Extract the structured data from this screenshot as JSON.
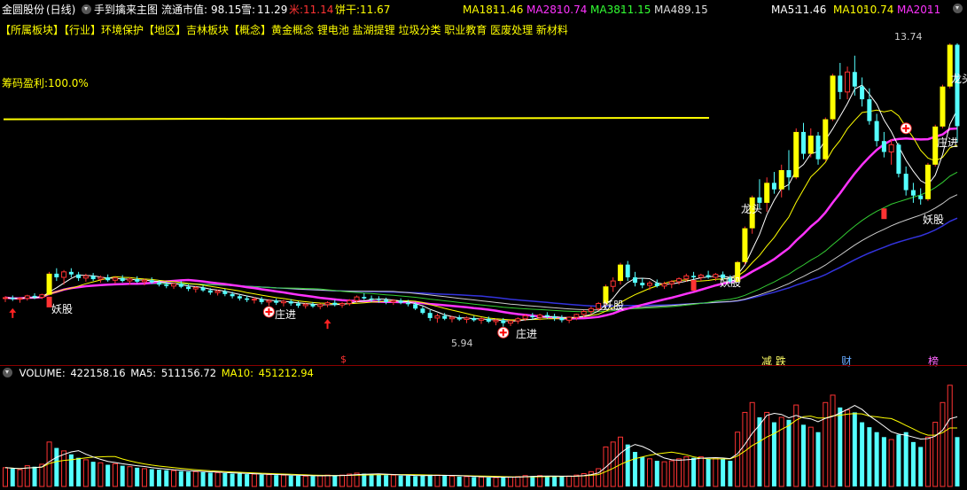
{
  "title_bar": {
    "stock_name": "金圆股份",
    "period": "(日线)",
    "formula_name": "手到擒来主图",
    "market_cap_label": "流通市值:",
    "market_cap_value": "98.15",
    "xue_label": "雪:",
    "xue_value": "11.29",
    "mi_label": "米:",
    "mi_value": "11.14",
    "bing_label": "饼干:",
    "bing_value": "11.67",
    "ma_mid": [
      {
        "label": "MA18:",
        "value": "11.46",
        "color": "#ffff00"
      },
      {
        "label": "MA28:",
        "value": "10.74",
        "color": "#ff33ff"
      },
      {
        "label": "MA38:",
        "value": "11.15",
        "color": "#33ff33"
      },
      {
        "label": "MA48:",
        "value": "9.15",
        "color": "#dddddd"
      }
    ],
    "ma_right": [
      {
        "label": "MA5:",
        "value": "11.46",
        "color": "#ffffff"
      },
      {
        "label": "MA10:",
        "value": "10.74",
        "color": "#ffff00"
      },
      {
        "label": "MA20:",
        "value": "11",
        "color": "#ff33ff"
      }
    ]
  },
  "sector_bar": "【所属板块】【行业】环境保护【地区】吉林板块【概念】黄金概念 锂电池 盐湖提锂 垃圾分类 职业教育 医废处理 新材料",
  "chip_profit": "筹码盈利:100.0%",
  "annotations": {
    "yaogu_1": "妖股",
    "yaogu_2": "妖股",
    "yaogu_3": "妖股",
    "yaogu_4": "妖股",
    "zhuangjin_1": "庄进",
    "zhuangjin_2": "庄进",
    "zhuangjin_3": "庄进",
    "longtou_1": "龙头",
    "longtou_2": "龙头",
    "low_price": "5.94",
    "high_price": "13.74",
    "dollar_mark": "$",
    "jian_die": "减 跌",
    "cai": "财",
    "bang": "榜"
  },
  "volume_bar": {
    "volume_label": "VOLUME:",
    "volume_value": "422158.16",
    "ma5_label": "MA5:",
    "ma5_value": "511156.72",
    "ma10_label": "MA10:",
    "ma10_value": "451212.94"
  },
  "colors": {
    "up": "#ff3333",
    "down": "#54ffff",
    "ma5": "#ffffff",
    "ma10": "#ffff00",
    "ma20": "#ff33ff",
    "ma38": "#33cc33",
    "ma48": "#cccccc",
    "long": "#3333dd",
    "chip": "#ffff00"
  },
  "chart_data": {
    "type": "candlestick",
    "price_range": [
      5.3,
      14.2
    ],
    "candles": [
      [
        6.72,
        6.78,
        6.62,
        6.74,
        380
      ],
      [
        6.74,
        6.8,
        6.65,
        6.7,
        360
      ],
      [
        6.7,
        6.76,
        6.6,
        6.72,
        340
      ],
      [
        6.72,
        6.82,
        6.66,
        6.79,
        420
      ],
      [
        6.79,
        6.86,
        6.7,
        6.75,
        400
      ],
      [
        6.75,
        6.85,
        6.7,
        6.82,
        450
      ],
      [
        6.82,
        7.45,
        6.8,
        7.4,
        900
      ],
      [
        7.4,
        7.55,
        7.2,
        7.3,
        780
      ],
      [
        7.3,
        7.5,
        7.1,
        7.45,
        720
      ],
      [
        7.45,
        7.55,
        7.3,
        7.38,
        650
      ],
      [
        7.38,
        7.45,
        7.2,
        7.28,
        580
      ],
      [
        7.28,
        7.4,
        7.18,
        7.34,
        540
      ],
      [
        7.34,
        7.42,
        7.2,
        7.25,
        500
      ],
      [
        7.25,
        7.35,
        7.15,
        7.3,
        480
      ],
      [
        7.3,
        7.38,
        7.18,
        7.22,
        440
      ],
      [
        7.22,
        7.32,
        7.12,
        7.28,
        460
      ],
      [
        7.28,
        7.36,
        7.16,
        7.2,
        420
      ],
      [
        7.2,
        7.3,
        7.1,
        7.25,
        400
      ],
      [
        7.25,
        7.33,
        7.14,
        7.18,
        380
      ],
      [
        7.18,
        7.26,
        7.08,
        7.22,
        360
      ],
      [
        7.22,
        7.3,
        7.12,
        7.16,
        350
      ],
      [
        7.16,
        7.22,
        7.05,
        7.1,
        340
      ],
      [
        7.1,
        7.18,
        7.0,
        7.06,
        330
      ],
      [
        7.06,
        7.14,
        6.98,
        7.12,
        320
      ],
      [
        7.12,
        7.2,
        7.0,
        7.04,
        310
      ],
      [
        7.04,
        7.1,
        6.92,
        6.98,
        300
      ],
      [
        6.98,
        7.06,
        6.88,
        7.02,
        300
      ],
      [
        7.02,
        7.08,
        6.9,
        6.94,
        290
      ],
      [
        6.94,
        7.0,
        6.82,
        6.88,
        280
      ],
      [
        6.88,
        6.96,
        6.8,
        6.92,
        280
      ],
      [
        6.92,
        6.98,
        6.78,
        6.84,
        270
      ],
      [
        6.84,
        6.9,
        6.72,
        6.78,
        260
      ],
      [
        6.78,
        6.84,
        6.66,
        6.72,
        260
      ],
      [
        6.72,
        6.8,
        6.62,
        6.68,
        250
      ],
      [
        6.68,
        6.76,
        6.58,
        6.7,
        250
      ],
      [
        6.7,
        6.76,
        6.56,
        6.62,
        240
      ],
      [
        6.62,
        6.7,
        6.52,
        6.66,
        240
      ],
      [
        6.66,
        6.72,
        6.54,
        6.6,
        230
      ],
      [
        6.6,
        6.68,
        6.5,
        6.64,
        230
      ],
      [
        6.64,
        6.7,
        6.52,
        6.58,
        220
      ],
      [
        6.58,
        6.64,
        6.46,
        6.52,
        220
      ],
      [
        6.52,
        6.6,
        6.44,
        6.56,
        210
      ],
      [
        6.56,
        6.62,
        6.46,
        6.5,
        210
      ],
      [
        6.5,
        6.58,
        6.42,
        6.55,
        220
      ],
      [
        6.55,
        6.64,
        6.48,
        6.6,
        230
      ],
      [
        6.6,
        6.68,
        6.5,
        6.54,
        220
      ],
      [
        6.54,
        6.62,
        6.46,
        6.58,
        230
      ],
      [
        6.58,
        6.7,
        6.52,
        6.66,
        250
      ],
      [
        6.66,
        6.8,
        6.6,
        6.76,
        270
      ],
      [
        6.76,
        6.86,
        6.68,
        6.72,
        260
      ],
      [
        6.72,
        6.8,
        6.62,
        6.7,
        250
      ],
      [
        6.7,
        6.78,
        6.6,
        6.68,
        240
      ],
      [
        6.68,
        6.74,
        6.56,
        6.62,
        230
      ],
      [
        6.62,
        6.7,
        6.54,
        6.66,
        230
      ],
      [
        6.66,
        6.72,
        6.56,
        6.6,
        220
      ],
      [
        6.6,
        6.68,
        6.5,
        6.56,
        220
      ],
      [
        6.56,
        6.62,
        6.4,
        6.44,
        210
      ],
      [
        6.44,
        6.5,
        6.28,
        6.32,
        220
      ],
      [
        6.32,
        6.4,
        6.1,
        6.18,
        240
      ],
      [
        6.18,
        6.3,
        6.05,
        6.24,
        230
      ],
      [
        6.24,
        6.32,
        6.12,
        6.16,
        220
      ],
      [
        6.16,
        6.24,
        6.06,
        6.2,
        210
      ],
      [
        6.2,
        6.26,
        6.1,
        6.14,
        200
      ],
      [
        6.14,
        6.22,
        6.04,
        6.18,
        200
      ],
      [
        6.18,
        6.24,
        6.08,
        6.12,
        190
      ],
      [
        6.12,
        6.2,
        6.02,
        6.16,
        190
      ],
      [
        6.16,
        6.22,
        6.04,
        6.08,
        180
      ],
      [
        6.08,
        6.16,
        5.98,
        6.12,
        180
      ],
      [
        6.12,
        6.18,
        5.94,
        6.04,
        200
      ],
      [
        6.04,
        6.12,
        5.96,
        6.1,
        190
      ],
      [
        6.1,
        6.2,
        6.02,
        6.16,
        200
      ],
      [
        6.16,
        6.28,
        6.1,
        6.24,
        220
      ],
      [
        6.24,
        6.32,
        6.14,
        6.2,
        210
      ],
      [
        6.2,
        6.3,
        6.12,
        6.26,
        220
      ],
      [
        6.26,
        6.34,
        6.16,
        6.22,
        210
      ],
      [
        6.22,
        6.3,
        6.1,
        6.18,
        200
      ],
      [
        6.18,
        6.26,
        6.06,
        6.12,
        200
      ],
      [
        6.12,
        6.22,
        6.04,
        6.2,
        210
      ],
      [
        6.2,
        6.3,
        6.12,
        6.28,
        230
      ],
      [
        6.28,
        6.4,
        6.2,
        6.36,
        260
      ],
      [
        6.36,
        6.5,
        6.28,
        6.44,
        300
      ],
      [
        6.44,
        6.62,
        6.38,
        6.58,
        360
      ],
      [
        6.58,
        7.1,
        6.52,
        7.05,
        800
      ],
      [
        7.05,
        7.3,
        6.9,
        7.2,
        900
      ],
      [
        7.2,
        7.7,
        7.1,
        7.65,
        1000
      ],
      [
        7.65,
        7.75,
        7.2,
        7.3,
        850
      ],
      [
        7.3,
        7.45,
        7.05,
        7.15,
        700
      ],
      [
        7.15,
        7.28,
        7.0,
        7.08,
        600
      ],
      [
        7.08,
        7.2,
        6.95,
        7.14,
        560
      ],
      [
        7.14,
        7.24,
        7.02,
        7.06,
        520
      ],
      [
        7.06,
        7.18,
        6.98,
        7.12,
        500
      ],
      [
        7.12,
        7.22,
        7.0,
        7.18,
        520
      ],
      [
        7.18,
        7.3,
        7.1,
        7.26,
        560
      ],
      [
        7.26,
        7.4,
        7.18,
        7.34,
        600
      ],
      [
        7.34,
        7.45,
        7.24,
        7.3,
        580
      ],
      [
        7.3,
        7.4,
        7.2,
        7.36,
        600
      ],
      [
        7.36,
        7.48,
        7.26,
        7.3,
        560
      ],
      [
        7.3,
        7.42,
        7.2,
        7.38,
        580
      ],
      [
        7.38,
        7.46,
        7.24,
        7.28,
        560
      ],
      [
        7.28,
        7.36,
        7.12,
        7.18,
        520
      ],
      [
        7.18,
        7.75,
        7.15,
        7.72,
        1100
      ],
      [
        7.72,
        8.7,
        7.65,
        8.65,
        1500
      ],
      [
        8.65,
        9.55,
        8.5,
        9.5,
        1700
      ],
      [
        9.5,
        10.0,
        9.2,
        9.35,
        1400
      ],
      [
        9.35,
        10.05,
        9.1,
        9.9,
        1500
      ],
      [
        9.9,
        10.2,
        9.6,
        9.72,
        1300
      ],
      [
        9.72,
        10.4,
        9.5,
        10.25,
        1400
      ],
      [
        10.25,
        10.8,
        9.7,
        10.05,
        1350
      ],
      [
        10.05,
        11.4,
        10.0,
        11.3,
        1650
      ],
      [
        11.3,
        11.55,
        10.55,
        10.7,
        1250
      ],
      [
        10.7,
        11.4,
        10.6,
        11.2,
        1200
      ],
      [
        11.2,
        11.3,
        10.4,
        10.55,
        1100
      ],
      [
        10.55,
        11.7,
        10.5,
        11.65,
        1700
      ],
      [
        11.65,
        12.9,
        11.6,
        12.85,
        1850
      ],
      [
        12.85,
        13.2,
        12.2,
        12.4,
        1600
      ],
      [
        12.4,
        13.1,
        12.2,
        12.95,
        1550
      ],
      [
        12.95,
        13.4,
        12.3,
        12.55,
        1500
      ],
      [
        12.55,
        12.8,
        12.0,
        12.2,
        1300
      ],
      [
        12.2,
        12.5,
        11.5,
        11.6,
        1200
      ],
      [
        11.6,
        11.8,
        10.9,
        11.05,
        1100
      ],
      [
        11.05,
        11.3,
        10.6,
        10.75,
        1000
      ],
      [
        10.75,
        11.1,
        10.4,
        10.95,
        950
      ],
      [
        10.95,
        11.0,
        10.05,
        10.15,
        1050
      ],
      [
        10.15,
        10.35,
        9.55,
        9.7,
        1100
      ],
      [
        9.7,
        9.9,
        9.35,
        9.55,
        900
      ],
      [
        9.55,
        9.75,
        9.3,
        9.45,
        800
      ],
      [
        9.45,
        10.45,
        9.4,
        10.4,
        1000
      ],
      [
        10.4,
        11.5,
        10.35,
        11.45,
        1300
      ],
      [
        11.45,
        12.6,
        11.4,
        12.55,
        1700
      ],
      [
        12.55,
        13.74,
        12.5,
        13.7,
        2050
      ],
      [
        13.7,
        13.74,
        11.0,
        11.46,
        1000
      ]
    ]
  }
}
